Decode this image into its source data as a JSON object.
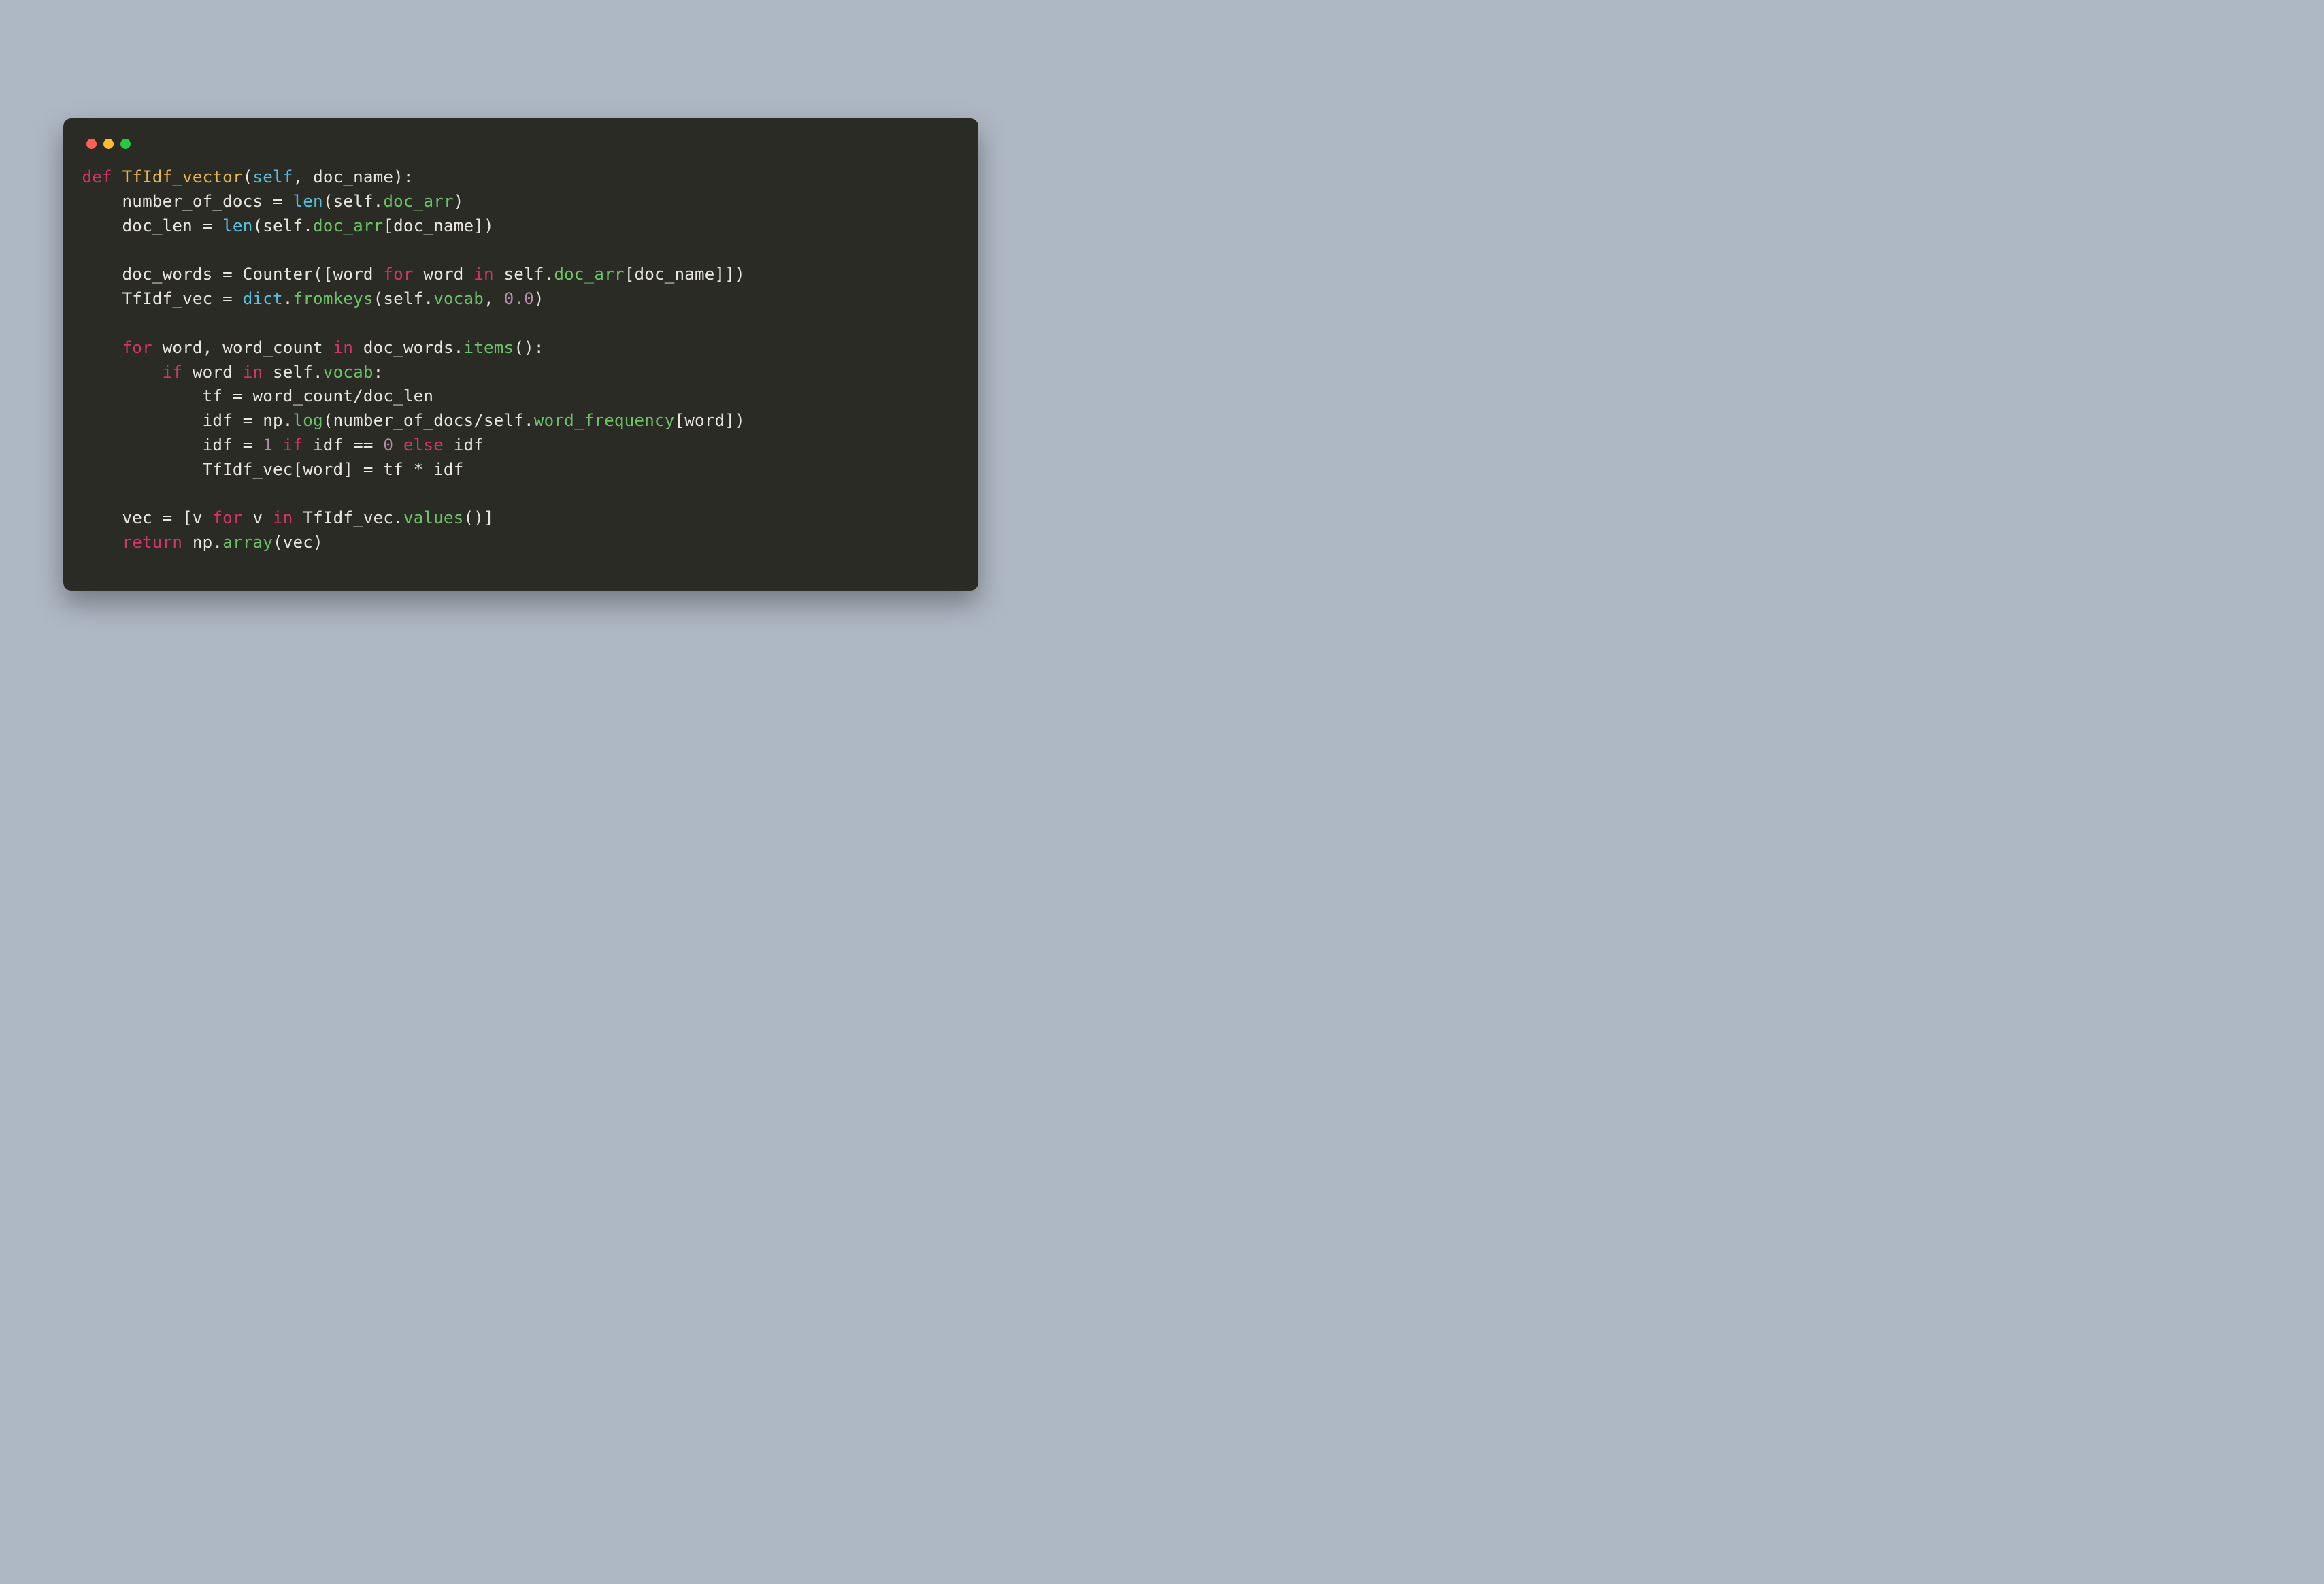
{
  "window": {
    "traffic_lights": [
      "red",
      "yellow",
      "green"
    ]
  },
  "code": {
    "tokens": [
      [
        [
          "kw",
          "def "
        ],
        [
          "fname",
          "TfIdf_vector"
        ],
        [
          "plain",
          "("
        ],
        [
          "builtin",
          "self"
        ],
        [
          "plain",
          ", doc_name):"
        ]
      ],
      [
        [
          "plain",
          "    number_of_docs = "
        ],
        [
          "builtin",
          "len"
        ],
        [
          "plain",
          "(self."
        ],
        [
          "call",
          "doc_arr"
        ],
        [
          "plain",
          ")"
        ]
      ],
      [
        [
          "plain",
          "    doc_len = "
        ],
        [
          "builtin",
          "len"
        ],
        [
          "plain",
          "(self."
        ],
        [
          "call",
          "doc_arr"
        ],
        [
          "plain",
          "[doc_name])"
        ]
      ],
      [
        [
          "plain",
          ""
        ]
      ],
      [
        [
          "plain",
          "    doc_words = Counter([word "
        ],
        [
          "kw",
          "for"
        ],
        [
          "plain",
          " word "
        ],
        [
          "kw",
          "in"
        ],
        [
          "plain",
          " self."
        ],
        [
          "call",
          "doc_arr"
        ],
        [
          "plain",
          "[doc_name]])"
        ]
      ],
      [
        [
          "plain",
          "    TfIdf_vec = "
        ],
        [
          "builtin",
          "dict"
        ],
        [
          "plain",
          "."
        ],
        [
          "call",
          "fromkeys"
        ],
        [
          "plain",
          "(self."
        ],
        [
          "call",
          "vocab"
        ],
        [
          "plain",
          ", "
        ],
        [
          "const",
          "0.0"
        ],
        [
          "plain",
          ")"
        ]
      ],
      [
        [
          "plain",
          ""
        ]
      ],
      [
        [
          "plain",
          "    "
        ],
        [
          "kw",
          "for"
        ],
        [
          "plain",
          " word, word_count "
        ],
        [
          "kw",
          "in"
        ],
        [
          "plain",
          " doc_words."
        ],
        [
          "call",
          "items"
        ],
        [
          "plain",
          "():"
        ]
      ],
      [
        [
          "plain",
          "        "
        ],
        [
          "kw",
          "if"
        ],
        [
          "plain",
          " word "
        ],
        [
          "kw",
          "in"
        ],
        [
          "plain",
          " self."
        ],
        [
          "call",
          "vocab"
        ],
        [
          "plain",
          ":"
        ]
      ],
      [
        [
          "plain",
          "            tf = word_count/doc_len"
        ]
      ],
      [
        [
          "plain",
          "            idf = np."
        ],
        [
          "call",
          "log"
        ],
        [
          "plain",
          "(number_of_docs/self."
        ],
        [
          "call",
          "word_frequency"
        ],
        [
          "plain",
          "[word])"
        ]
      ],
      [
        [
          "plain",
          "            idf = "
        ],
        [
          "const",
          "1"
        ],
        [
          "plain",
          " "
        ],
        [
          "kw",
          "if"
        ],
        [
          "plain",
          " idf == "
        ],
        [
          "const",
          "0"
        ],
        [
          "plain",
          " "
        ],
        [
          "kw",
          "else"
        ],
        [
          "plain",
          " idf"
        ]
      ],
      [
        [
          "plain",
          "            TfIdf_vec[word] = tf * idf"
        ]
      ],
      [
        [
          "plain",
          ""
        ]
      ],
      [
        [
          "plain",
          "    vec = [v "
        ],
        [
          "kw",
          "for"
        ],
        [
          "plain",
          " v "
        ],
        [
          "kw",
          "in"
        ],
        [
          "plain",
          " TfIdf_vec."
        ],
        [
          "call",
          "values"
        ],
        [
          "plain",
          "()]"
        ]
      ],
      [
        [
          "plain",
          "    "
        ],
        [
          "kw",
          "return"
        ],
        [
          "plain",
          " np."
        ],
        [
          "call",
          "array"
        ],
        [
          "plain",
          "(vec)"
        ]
      ]
    ]
  }
}
